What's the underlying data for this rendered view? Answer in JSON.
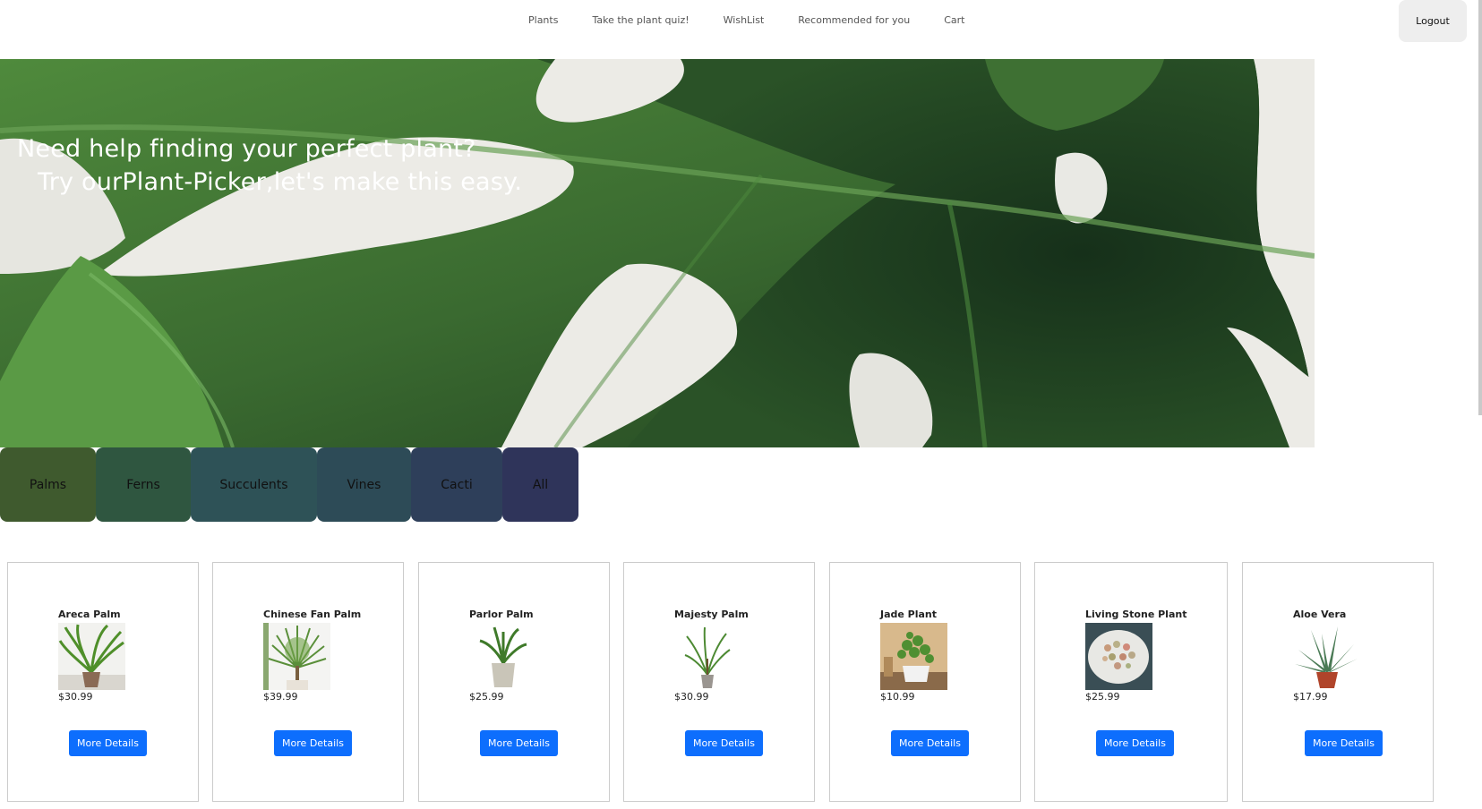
{
  "nav": {
    "links": [
      "Plants",
      "Take the plant quiz!",
      "WishList",
      "Recommended for you",
      "Cart"
    ],
    "logout_label": "Logout"
  },
  "hero": {
    "line1": "Need help finding your perfect plant?",
    "line2": "Try ourPlant-Picker,let's make this easy."
  },
  "categories": [
    {
      "label": "Palms",
      "color": "#3f5a2e"
    },
    {
      "label": "Ferns",
      "color": "#2f5640"
    },
    {
      "label": "Succulents",
      "color": "#2e5257"
    },
    {
      "label": "Vines",
      "color": "#2d4b57"
    },
    {
      "label": "Cacti",
      "color": "#2e3f5a"
    },
    {
      "label": "All",
      "color": "#2f345a"
    }
  ],
  "products": [
    {
      "name": "Areca Palm",
      "price": "$30.99",
      "image": "areca-palm-photo"
    },
    {
      "name": "Chinese Fan Palm",
      "price": "$39.99",
      "image": "chinese-fan-palm-photo"
    },
    {
      "name": "Parlor Palm",
      "price": "$25.99",
      "image": "parlor-palm-photo"
    },
    {
      "name": "Majesty Palm",
      "price": "$30.99",
      "image": "majesty-palm-photo"
    },
    {
      "name": "Jade Plant",
      "price": "$10.99",
      "image": "jade-plant-photo"
    },
    {
      "name": "Living Stone Plant",
      "price": "$25.99",
      "image": "living-stone-plant-photo"
    },
    {
      "name": "Aloe Vera",
      "price": "$17.99",
      "image": "aloe-vera-photo"
    }
  ],
  "more_details_label": "More Details",
  "colors": {
    "button_blue": "#0d6efd",
    "leaf_green": "#3d6b34"
  }
}
